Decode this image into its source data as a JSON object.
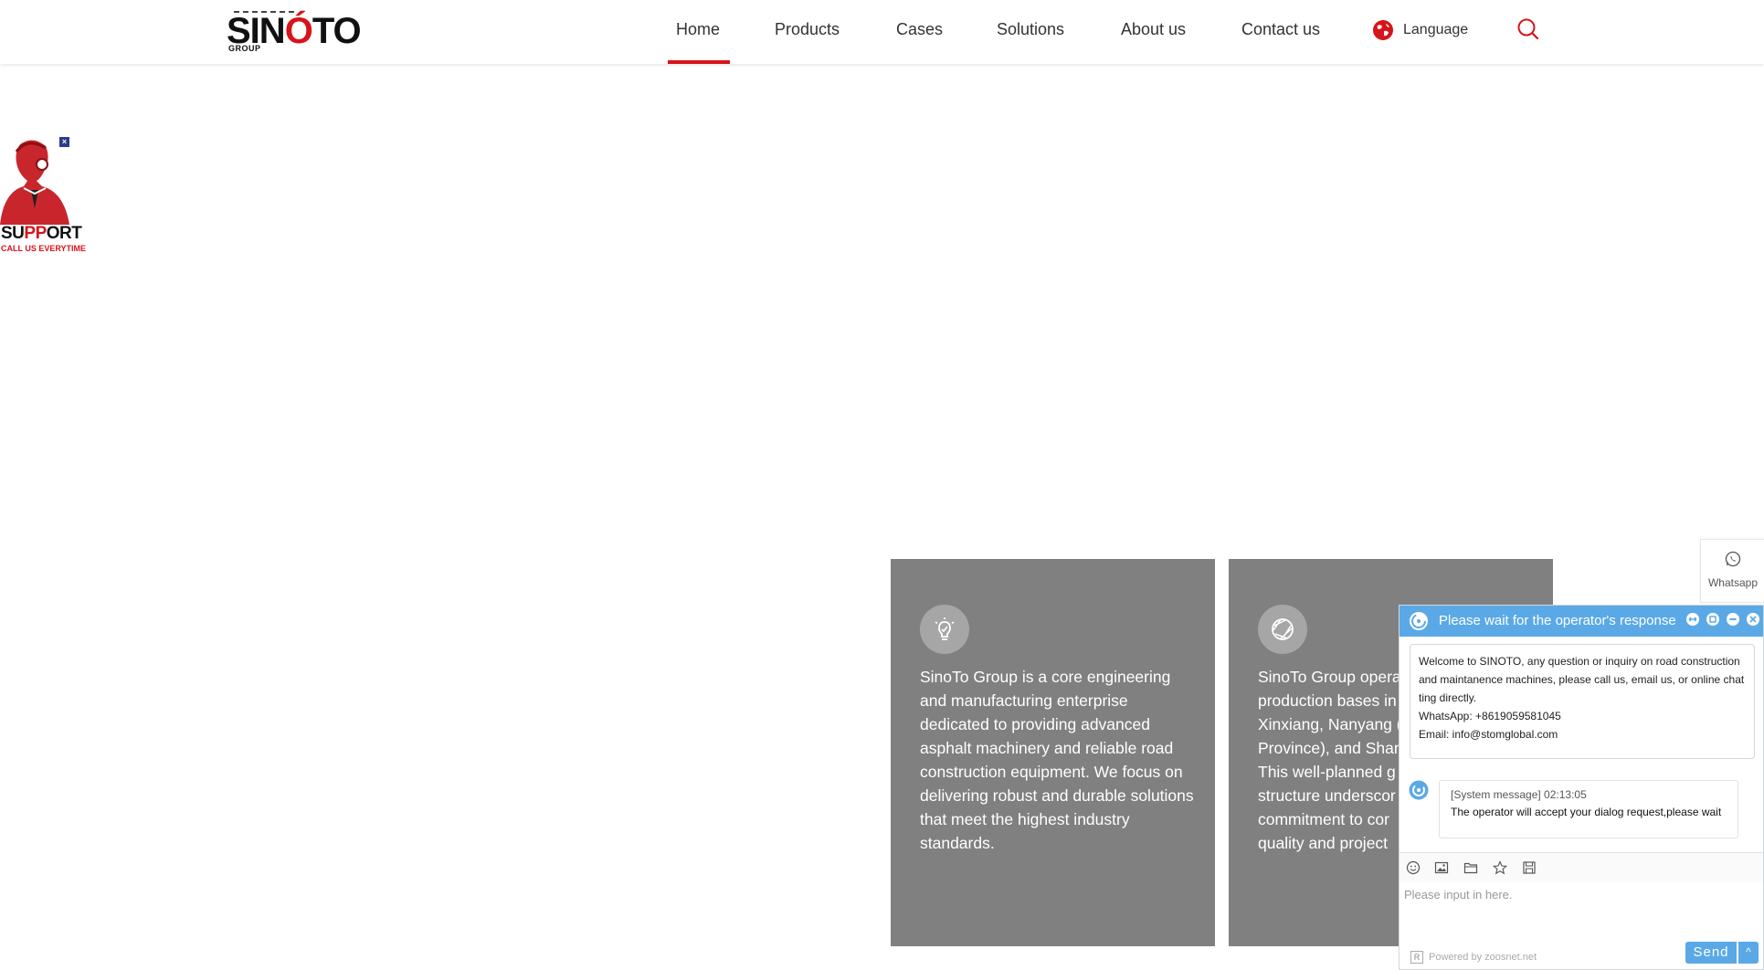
{
  "header": {
    "logo_text_prefix": "SIN",
    "logo_text_accent": "Ó",
    "logo_text_suffix": "TO",
    "logo_subtext": "GROUP",
    "nav": [
      {
        "label": "Home",
        "active": true
      },
      {
        "label": "Products"
      },
      {
        "label": "Cases"
      },
      {
        "label": "Solutions"
      },
      {
        "label": "About us"
      },
      {
        "label": "Contact us"
      }
    ],
    "language_label": "Language",
    "accent_color": "#d7141b",
    "search_icon": "search-icon",
    "language_icon": "globe-icon"
  },
  "support": {
    "title_part1": "SU",
    "title_part2": "PP",
    "title_part3": "ORT",
    "subtitle": "CALL US EVERYTIME",
    "close_label": "×"
  },
  "cards": [
    {
      "icon": "lightbulb-icon",
      "text": "SinoTo Group is a core engineering and manufacturing enterprise dedicated to providing advanced asphalt machinery and reliable road construction equipment. We focus on delivering robust and durable solutions that meet the highest industry standards."
    },
    {
      "icon": "aperture-icon",
      "text": "SinoTo Group opera\nproduction bases in\nXinxiang, Nanyang (\nProvince), and Shan\nThis well-planned g\nstructure underscor\ncommitment to cor\nquality and project"
    }
  ],
  "whatsapp": {
    "label": "Whatsapp"
  },
  "chat": {
    "title": "Please wait for the operator's response",
    "welcome_lines": [
      "Welcome to SINOTO, any question or inquiry on road construction and maintanence machines, please call us, email us, or online chatting directly.",
      "WhatsApp: +8619059581045",
      "Email: info@stomglobal.com"
    ],
    "system_header": "[System message] 02:13:05",
    "system_message": "The operator will accept your dialog request,please wait",
    "input_placeholder": "Please input in here.",
    "send_label": "Send",
    "send_more_label": "^",
    "powered_badge": "R",
    "powered_by": "Powered by zoosnet.net",
    "header_color": "#5aa9e6"
  }
}
